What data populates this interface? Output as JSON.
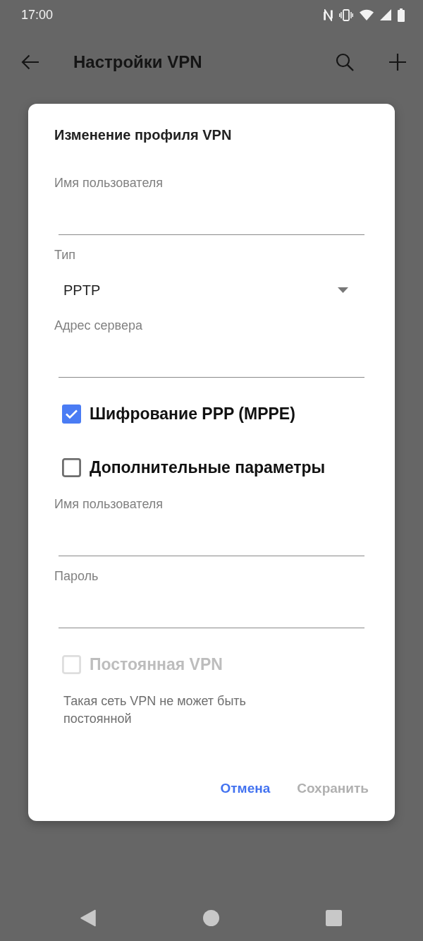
{
  "status_bar": {
    "time": "17:00"
  },
  "app_bar": {
    "title": "Настройки VPN"
  },
  "dialog": {
    "title": "Изменение профиля VPN",
    "items": [
      {
        "kind": "text_field",
        "label": "Имя пользователя"
      },
      {
        "kind": "dropdown",
        "label": "Тип",
        "value": "PPTP"
      },
      {
        "kind": "text_field",
        "label": "Адрес сервера"
      },
      {
        "kind": "checkbox",
        "label": "Шифрование PPP (MPPE)",
        "checked": true,
        "disabled": false
      },
      {
        "kind": "checkbox",
        "label": "Дополнительные параметры",
        "checked": false,
        "disabled": false
      },
      {
        "kind": "text_field",
        "label": "Имя пользователя"
      },
      {
        "kind": "text_field",
        "label": "Пароль"
      },
      {
        "kind": "checkbox",
        "label": "Постоянная VPN",
        "checked": false,
        "disabled": true
      },
      {
        "kind": "note",
        "text": "Такая сеть VPN не может быть постоянной"
      }
    ],
    "buttons": [
      {
        "label": "Отмена",
        "disabled": false
      },
      {
        "label": "Сохранить",
        "disabled": true
      }
    ]
  }
}
